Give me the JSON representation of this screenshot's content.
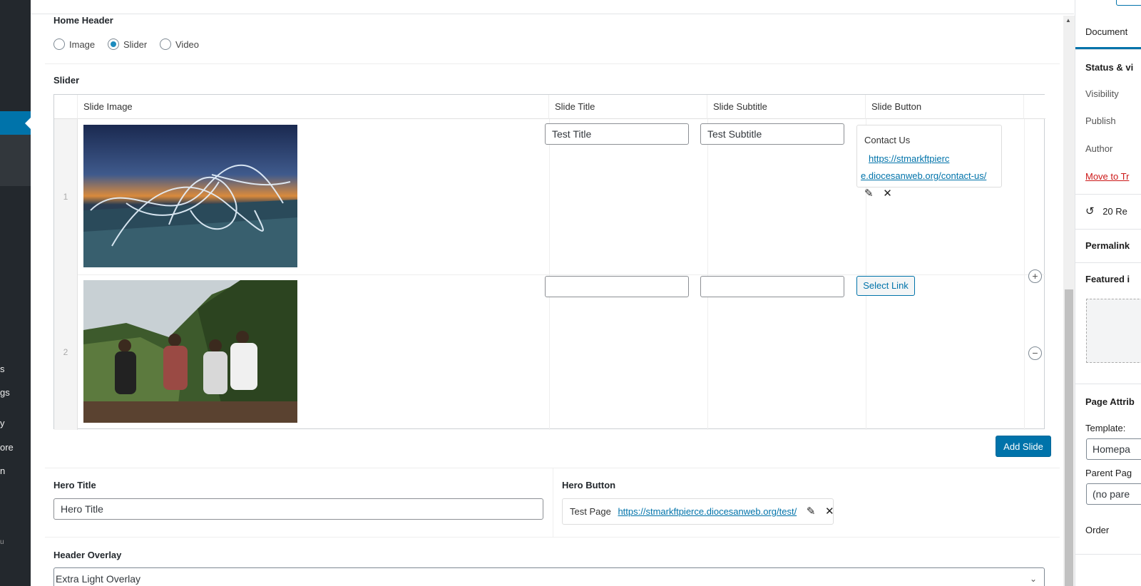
{
  "admin_menu": {
    "items": [
      "s",
      "gs",
      "y",
      "ore",
      "n",
      "u"
    ]
  },
  "home_header": {
    "label": "Home Header",
    "options": [
      "Image",
      "Slider",
      "Video"
    ],
    "selected": "Slider"
  },
  "slider": {
    "label": "Slider",
    "columns": [
      "Slide Image",
      "Slide Title",
      "Slide Subtitle",
      "Slide Button"
    ],
    "rows": [
      {
        "num": "1",
        "image": "light-trails-night-roof",
        "title": "Test Title",
        "subtitle": "Test Subtitle",
        "button_text": "Contact Us",
        "button_url_line1": "https://stmarkftpierc",
        "button_url_line2": "e.diocesanweb.org/contact-us/"
      },
      {
        "num": "2",
        "image": "four-men-sitting-on-hillside",
        "title": "",
        "subtitle": "",
        "button_label": "Select Link"
      }
    ],
    "add_label": "Add Slide"
  },
  "hero": {
    "title_label": "Hero Title",
    "title_value": "Hero Title",
    "button_label": "Hero Button",
    "button_text": "Test Page",
    "button_url": "https://stmarkftpierce.diocesanweb.org/test/"
  },
  "overlay": {
    "label": "Header Overlay",
    "value": "Extra Light Overlay"
  },
  "sidebar": {
    "tab": "Document",
    "status": "Status & vi",
    "visibility": "Visibility",
    "publish": "Publish",
    "author": "Author",
    "trash": "Move to Tr",
    "revisions": "20 Re",
    "permalink": "Permalink",
    "featured": "Featured i",
    "page_attr": "Page Attrib",
    "template_label": "Template:",
    "template_value": "Homepa",
    "parent_label": "Parent Pag",
    "parent_value": "(no pare",
    "order": "Order"
  },
  "colors": {
    "accent": "#0073aa",
    "admin_bg": "#23282d",
    "trash": "#cc1818"
  }
}
